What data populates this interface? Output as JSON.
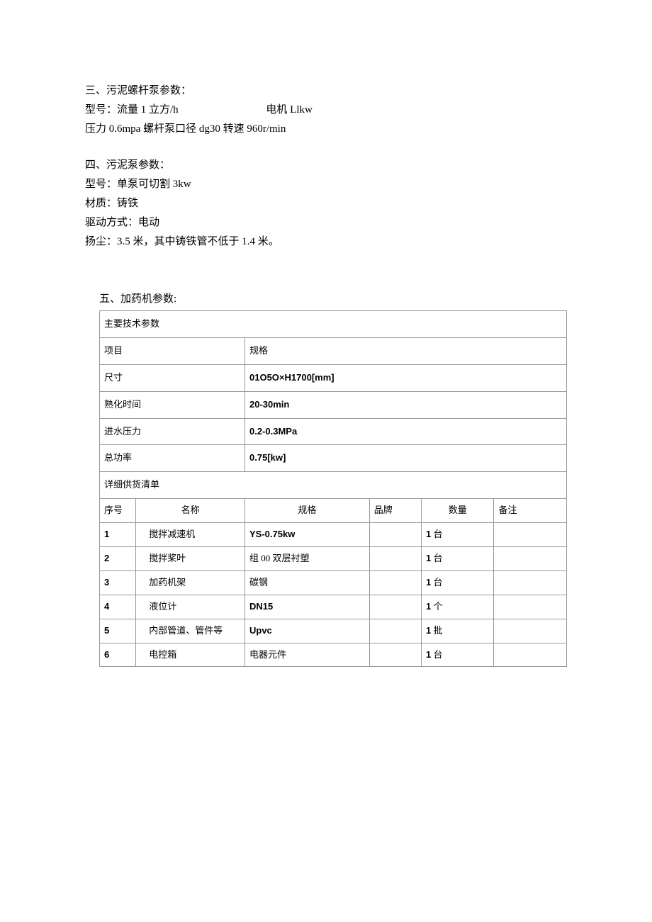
{
  "section3": {
    "title": "三、污泥螺杆泵参数：",
    "model_label": "型号：流量 1 立方/h",
    "motor_label": "电机 Llkw",
    "pressure_line": "压力 0.6mpa 螺杆泵口径 dg30 转速 960r/min"
  },
  "section4": {
    "title": "四、污泥泵参数：",
    "model": "型号：单泵可切割 3kw",
    "material": "材质：铸铁",
    "drive": "驱动方式：电动",
    "lift": "扬尘：3.5 米，其中铸铁管不低于 1.4 米。"
  },
  "section5": {
    "title": "五、加药机参数:",
    "main_params_header": "主要技术参数",
    "columns": {
      "item": "项目",
      "spec": "规格"
    },
    "params": [
      {
        "item": "尺寸",
        "spec": "01O5O×H1700[mm]"
      },
      {
        "item": "熟化时间",
        "spec": "20-30min"
      },
      {
        "item": "进水压力",
        "spec": "0.2-0.3MPa"
      },
      {
        "item": "总功率",
        "spec": "0.75[kw]"
      }
    ],
    "supply_header": "详细供货清单",
    "supply_columns": {
      "seq": "序号",
      "name": "名称",
      "spec": "规格",
      "brand": "品牌",
      "qty": "数量",
      "note": "备注"
    },
    "supply_rows": [
      {
        "seq": "1",
        "name": "搅拌减速机",
        "spec_bold": "YS-0.75kw",
        "spec_plain": "",
        "brand": "",
        "qty_num": "1",
        "qty_unit": " 台",
        "note": ""
      },
      {
        "seq": "2",
        "name": "搅拌桨叶",
        "spec_bold": "",
        "spec_plain": "组 00 双层衬塑",
        "brand": "",
        "qty_num": "1",
        "qty_unit": " 台",
        "note": ""
      },
      {
        "seq": "3",
        "name": "加药机架",
        "spec_bold": "",
        "spec_plain": "碳钢",
        "brand": "",
        "qty_num": "1",
        "qty_unit": " 台",
        "note": ""
      },
      {
        "seq": "4",
        "name": "液位计",
        "spec_bold": "DN15",
        "spec_plain": "",
        "brand": "",
        "qty_num": "1",
        "qty_unit": " 个",
        "note": ""
      },
      {
        "seq": "5",
        "name": "内部管道、管件等",
        "spec_bold": "Upvc",
        "spec_plain": "",
        "brand": "",
        "qty_num": "1",
        "qty_unit": " 批",
        "note": ""
      },
      {
        "seq": "6",
        "name": "电控箱",
        "spec_bold": "",
        "spec_plain": "电器元件",
        "brand": "",
        "qty_num": "1",
        "qty_unit": " 台",
        "note": ""
      }
    ]
  }
}
